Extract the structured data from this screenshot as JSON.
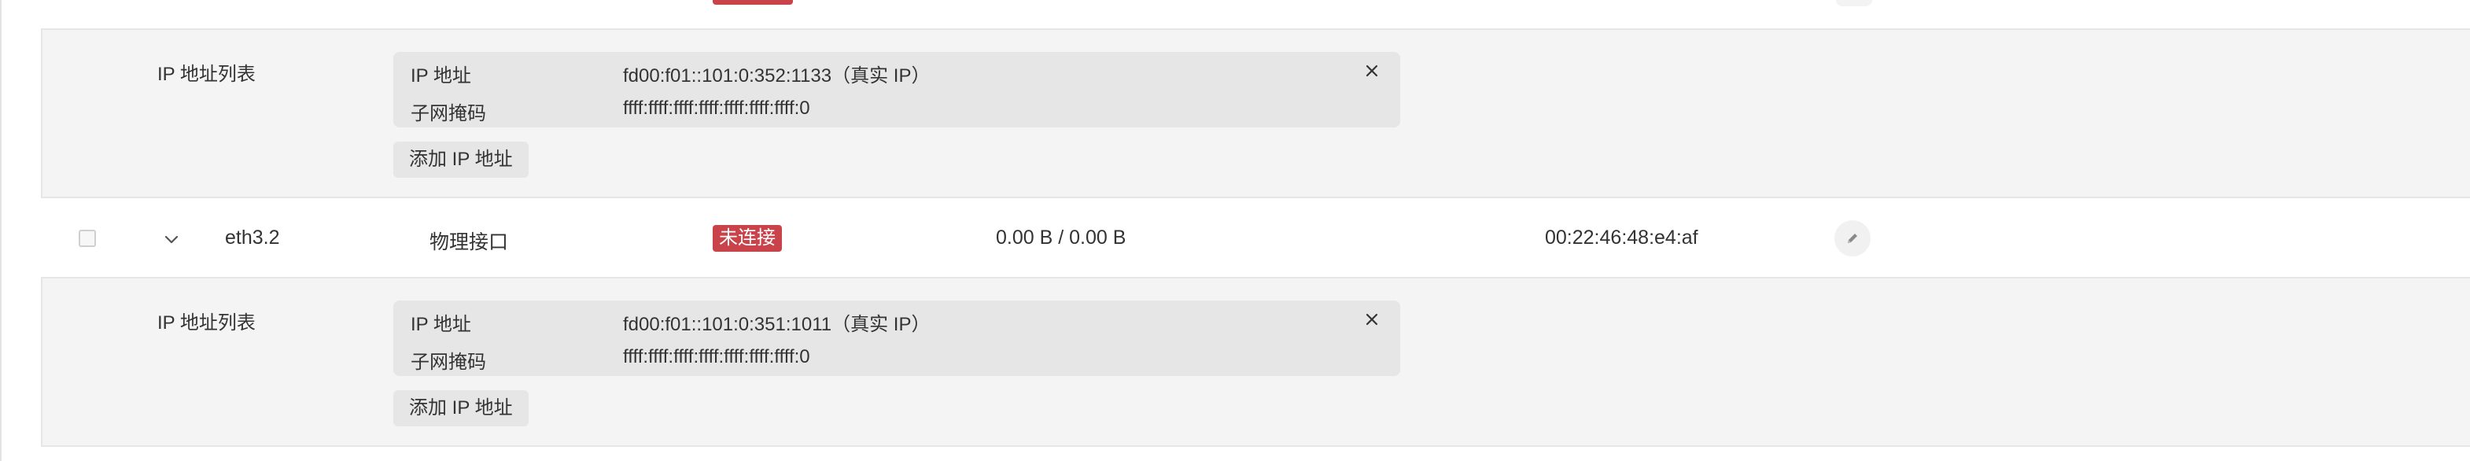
{
  "colors": {
    "status_disconnected": "#c9434b",
    "panel_bg": "#f4f4f4",
    "ip_box_bg": "#e6e6e6"
  },
  "panels": [
    {
      "label": "IP 地址列表",
      "entries": [
        {
          "ip_key": "IP 地址",
          "ip_value": "fd00:f01::101:0:352:1133（真实 IP）",
          "mask_key": "子网掩码",
          "mask_value": "ffff:ffff:ffff:ffff:ffff:ffff:ffff:0",
          "remove_icon": "close-icon"
        }
      ],
      "add_button": "添加 IP 地址"
    },
    {
      "label": "IP 地址列表",
      "entries": [
        {
          "ip_key": "IP 地址",
          "ip_value": "fd00:f01::101:0:351:1011（真实 IP）",
          "mask_key": "子网掩码",
          "mask_value": "ffff:ffff:ffff:ffff:ffff:ffff:ffff:0",
          "remove_icon": "close-icon"
        }
      ],
      "add_button": "添加 IP 地址"
    }
  ],
  "interface_row": {
    "name": "eth3.2",
    "type": "物理接口",
    "status": "未连接",
    "traffic": "0.00 B / 0.00 B",
    "mac": "00:22:46:48:e4:af",
    "expand_icon": "chevron-down-icon",
    "edit_icon": "pencil-icon"
  }
}
